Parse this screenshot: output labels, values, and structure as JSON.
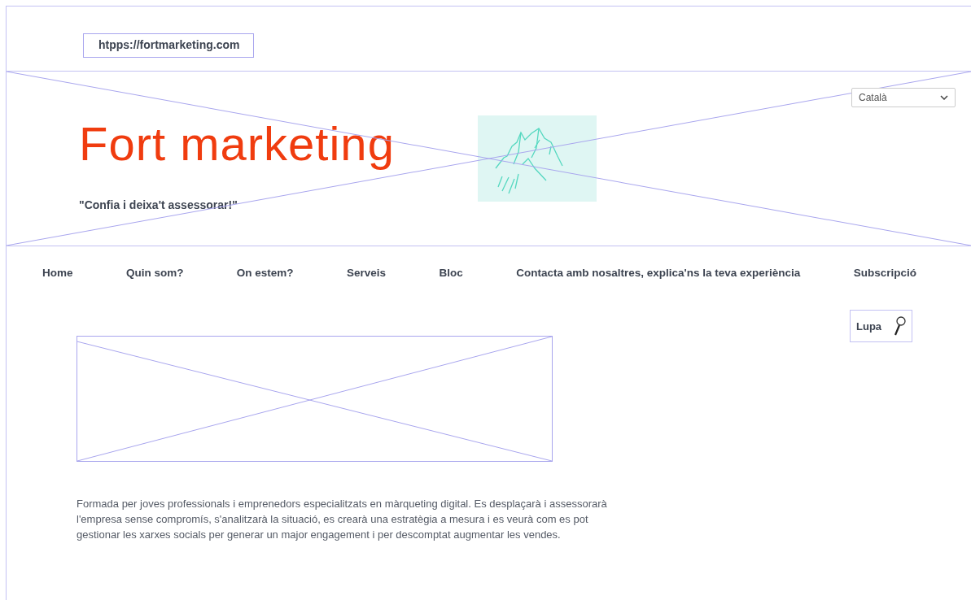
{
  "address_bar": {
    "url": "htpps://fortmarketing.com"
  },
  "header": {
    "kind": "placeholder",
    "title": "Fort marketing",
    "tagline": "\"Confia i deixa't assessorar!\"",
    "language_select": {
      "value": "Català"
    }
  },
  "nav": [
    {
      "label": "Home"
    },
    {
      "label": "Quin som?"
    },
    {
      "label": "On estem?"
    },
    {
      "label": "Serveis"
    },
    {
      "label": "Bloc"
    },
    {
      "label": "Contacta amb nosaltres, explica'ns la teva experiència"
    },
    {
      "label": "Subscripció"
    }
  ],
  "search_button": {
    "label": "Lupa"
  },
  "banner": {
    "kind": "placeholder"
  },
  "description": "Formada per joves professionals i emprenedors especialitzats en màrqueting digital. Es desplaçarà i assessorarà l'empresa sense compromís,  s'analitzarà la situació, es crearà una estratègia a mesura i es veurà com es pot  gestionar les xarxes socials per generar un major engagement  i per descomptat augmentar les vendes."
}
